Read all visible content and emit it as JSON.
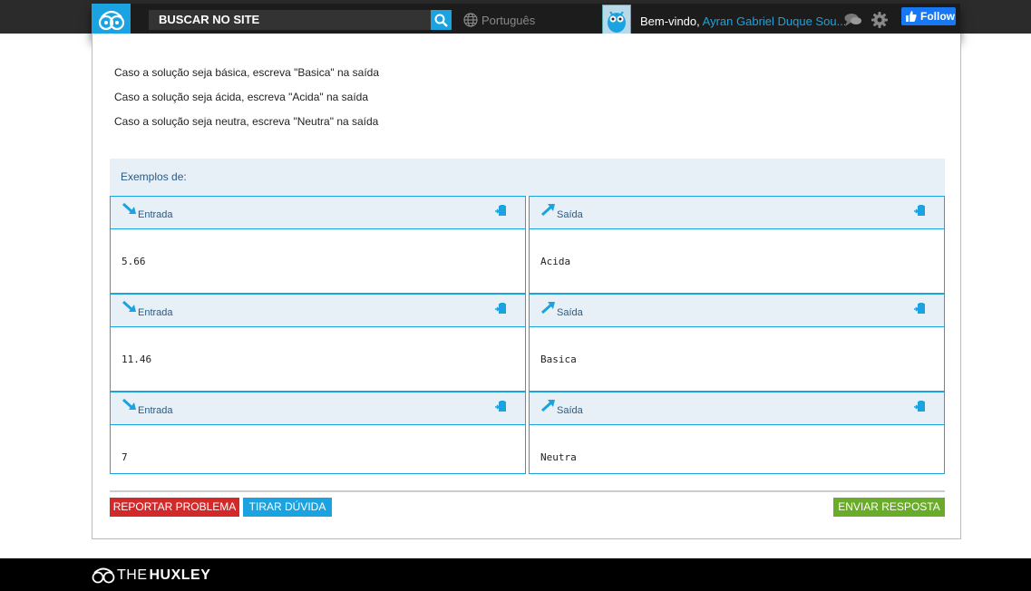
{
  "header": {
    "search_placeholder": "BUSCAR NO SITE",
    "language": "Português",
    "welcome_prefix": "Bem-vindo,",
    "user_name": "Ayran Gabriel Duque Sou...",
    "follow_label": "Follow"
  },
  "description": [
    "Caso a solução seja básica, escreva \"Basica\" na saída",
    "Caso a solução seja ácida, escreva \"Acida\" na saída",
    "Caso a solução seja neutra, escreva \"Neutra\" na saída"
  ],
  "examples": {
    "title": "Exemplos de:",
    "input_label": "Entrada",
    "output_label": "Saída",
    "cases": [
      {
        "input": "5.66",
        "output": "Acida"
      },
      {
        "input": "11.46",
        "output": "Basica"
      },
      {
        "input": "7",
        "output": "Neutra"
      }
    ]
  },
  "actions": {
    "report": "REPORTAR PROBLEMA",
    "doubt": "TIRAR DÚVIDA",
    "send": "ENVIAR RESPOSTA"
  },
  "footer": {
    "brand_prefix": "THE",
    "brand_suffix": "HUXLEY"
  },
  "colors": {
    "accent": "#1aa3e0",
    "danger": "#d22a2a",
    "success": "#6aab2a"
  }
}
